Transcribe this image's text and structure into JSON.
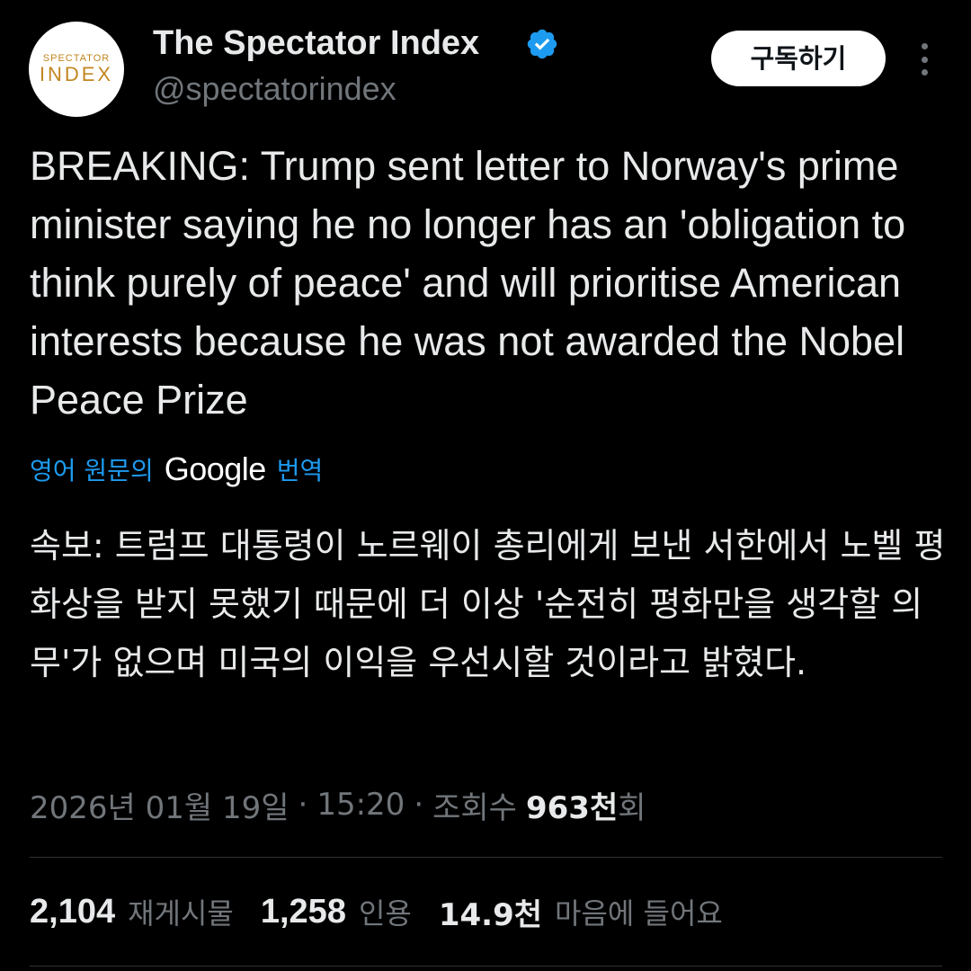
{
  "header": {
    "avatar": {
      "logo_line1": "SPECTATOR",
      "logo_line2": "INDEX"
    },
    "display_name": "The Spectator Index",
    "handle": "@spectatorindex",
    "verified_icon": "verified-badge-icon",
    "subscribe_label": "구독하기",
    "more_icon": "more-vertical-icon"
  },
  "tweet": {
    "text": "BREAKING: Trump sent letter to Norway's prime minister saying he no longer has an 'obligation to think purely of peace' and will prioritise American interests because he was not awarded the Nobel Peace Prize",
    "translate": {
      "prefix": "영어 원문의",
      "provider": "Google",
      "suffix": "번역"
    },
    "translated_text": "속보: 트럼프 대통령이 노르웨이 총리에게 보낸 서한에서 노벨 평화상을 받지 못했기 때문에 더 이상 '순전히 평화만을 생각할 의무'가 없으며 미국의 이익을 우선시할 것이라고 밝혔다."
  },
  "meta": {
    "date": "2026년 01월 19일",
    "time": "15:20",
    "views_label": "조회수",
    "views_count": "963천",
    "views_suffix": "회",
    "separator": "·"
  },
  "stats": {
    "reposts_value": "2,104",
    "reposts_label": "재게시물",
    "quotes_value": "1,258",
    "quotes_label": "인용",
    "likes_value": "14.9천",
    "likes_label": "마음에 들어요"
  },
  "colors": {
    "background": "#000000",
    "text_primary": "#e7e9ea",
    "text_secondary": "#71767b",
    "link_blue": "#1d9bf0",
    "verified_blue": "#1d9bf0",
    "logo_gold": "#c2861f",
    "divider": "#2f3336"
  }
}
